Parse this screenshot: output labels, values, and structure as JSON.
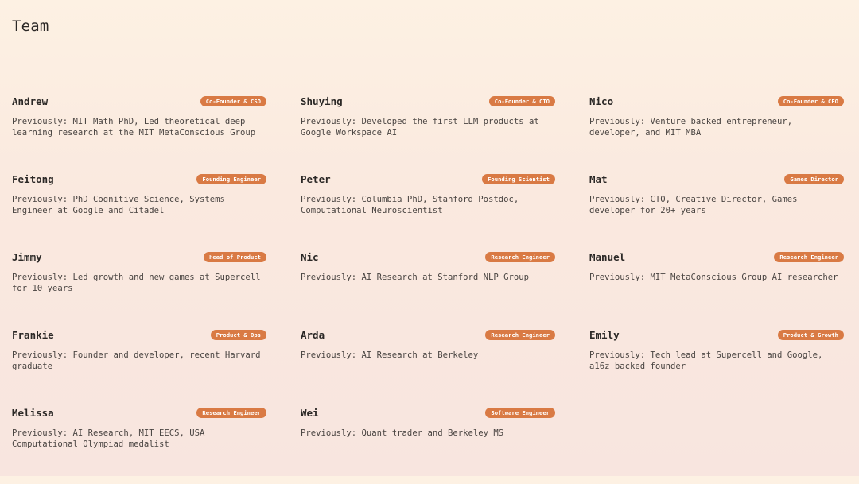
{
  "page": {
    "title": "Team"
  },
  "team": [
    {
      "name": "Andrew",
      "role": "Co-Founder & CSO",
      "bio": "Previously: MIT Math PhD, Led theoretical deep learning research at the MIT MetaConscious Group"
    },
    {
      "name": "Shuying",
      "role": "Co-Founder & CTO",
      "bio": "Previously: Developed the first LLM products at Google Workspace AI"
    },
    {
      "name": "Nico",
      "role": "Co-Founder & CEO",
      "bio": "Previously: Venture backed entrepreneur, developer, and MIT MBA"
    },
    {
      "name": "Feitong",
      "role": "Founding Engineer",
      "bio": "Previously: PhD Cognitive Science, Systems Engineer at Google and Citadel"
    },
    {
      "name": "Peter",
      "role": "Founding Scientist",
      "bio": "Previously: Columbia PhD, Stanford Postdoc, Computational Neuroscientist"
    },
    {
      "name": "Mat",
      "role": "Games Director",
      "bio": "Previously: CTO, Creative Director, Games developer for 20+ years"
    },
    {
      "name": "Jimmy",
      "role": "Head of Product",
      "bio": "Previously: Led growth and new games at Supercell for 10 years"
    },
    {
      "name": "Nic",
      "role": "Research Engineer",
      "bio": "Previously: AI Research at Stanford NLP Group"
    },
    {
      "name": "Manuel",
      "role": "Research Engineer",
      "bio": "Previously: MIT MetaConscious Group AI researcher"
    },
    {
      "name": "Frankie",
      "role": "Product & Ops",
      "bio": "Previously: Founder and developer, recent Harvard graduate"
    },
    {
      "name": "Arda",
      "role": "Research Engineer",
      "bio": "Previously: AI Research at Berkeley"
    },
    {
      "name": "Emily",
      "role": "Product & Growth",
      "bio": "Previously: Tech lead at Supercell and Google, a16z backed founder"
    },
    {
      "name": "Melissa",
      "role": "Research Engineer",
      "bio": "Previously: AI Research, MIT EECS, USA Computational Olympiad medalist"
    },
    {
      "name": "Wei",
      "role": "Software Engineer",
      "bio": "Previously: Quant trader and Berkeley MS"
    }
  ],
  "colors": {
    "badge": "#d97a44",
    "text": "#2b2826"
  }
}
